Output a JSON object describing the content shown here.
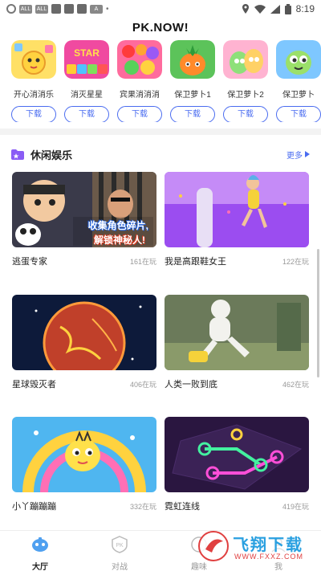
{
  "status_bar": {
    "time": "8:19",
    "tag1": "ALL",
    "tag2": "ALL",
    "tag3": "A"
  },
  "header": {
    "title": "PK.NOW!"
  },
  "top_games": [
    {
      "name": "开心消消乐",
      "download": "下载"
    },
    {
      "name": "消灭星星",
      "download": "下载"
    },
    {
      "name": "宾果消消消",
      "download": "下载"
    },
    {
      "name": "保卫萝卜1",
      "download": "下载"
    },
    {
      "name": "保卫萝卜2",
      "download": "下载"
    },
    {
      "name": "保卫萝卜",
      "download": "下载"
    }
  ],
  "section": {
    "title": "休闲娱乐",
    "more": "更多"
  },
  "cards": [
    {
      "title": "逃蛋专家",
      "count": "161在玩",
      "banner_line1": "收集角色碎片,",
      "banner_line2": "解锁神秘人!"
    },
    {
      "title": "我是高跟鞋女王",
      "count": "122在玩"
    },
    {
      "title": "星球毁灭者",
      "count": "406在玩"
    },
    {
      "title": "人类一败到底",
      "count": "462在玩"
    },
    {
      "title": "小丫蹦蹦蹦",
      "count": "332在玩"
    },
    {
      "title": "霓虹连线",
      "count": "419在玩"
    }
  ],
  "bottom_nav": [
    {
      "label": "大厅",
      "icon": "lobby-icon",
      "active": true
    },
    {
      "label": "对战",
      "icon": "pk-icon",
      "active": false
    },
    {
      "label": "趣味",
      "icon": "fun-icon",
      "active": false
    },
    {
      "label": "我",
      "icon": "profile-icon",
      "active": false
    }
  ],
  "watermark": {
    "text": "飞翔下载",
    "url": "WWW.FXXZ.COM"
  },
  "colors": {
    "accent": "#4a6cf0",
    "purple": "#8a5cf5"
  }
}
